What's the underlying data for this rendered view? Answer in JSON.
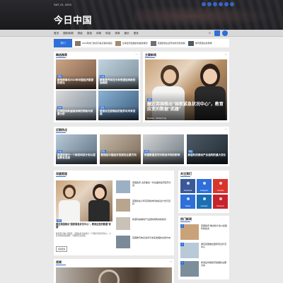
{
  "header": {
    "date": "SAT, 01, 2023",
    "site_title": "今日中国"
  },
  "nav": {
    "items": [
      "首页",
      "国际新闻",
      "财经",
      "旅游",
      "体育",
      "科技",
      "体育",
      "娱乐",
      "更多"
    ]
  },
  "ticker": {
    "label": "热门",
    "items": [
      "2023年热门新闻与焦点事件报道",
      "全球经济发展的新趋势展望",
      "英国旅游业复苏的新景象观察",
      "体育赛事全新赛季"
    ]
  },
  "section1": {
    "title": "精选推荐",
    "arrows": "‹ ›",
    "cards": [
      {
        "cat": "国际",
        "caption": "新冠病毒与2022年中国经济展望的变化"
      },
      {
        "cat": "科技",
        "caption": "新能源汽车在今年有望迎来新的高峰期"
      },
      {
        "cat": "财经",
        "caption": "在英国创新金融领域的突破与前景分析"
      },
      {
        "cat": "旅游",
        "caption": "旅游业在疫情后的复苏与未来发展"
      }
    ]
  },
  "section2": {
    "title": "主要新闻",
    "arrows": "‹ ›",
    "feature": {
      "cat": "国际",
      "caption": "据近英国推出\"国家紧急状况中心\"，教育应变的数据\"武器\"",
      "meta": "By Admin · 2023年1月1日"
    }
  },
  "section3": {
    "title": "近期热点",
    "arrows": "‹ ›",
    "cards": [
      {
        "cat": "科技",
        "caption": "英国将推行一个新的科技计划以提高教育发展"
      },
      {
        "cat": "国际",
        "caption": "新冠后中国经济发展的主要方向"
      },
      {
        "cat": "财经",
        "caption": "年度数据发布对财经市场的影响"
      },
      {
        "cat": "科技",
        "caption": "新型科技推动产业结构的重大变化"
      }
    ]
  },
  "section4": {
    "title": "深度报道",
    "feature": {
      "cat": "国际",
      "caption": "据近英国推出\"国家紧急状况中心\"，教育应变的数据\"武器\"",
      "excerpt": "据英国广播公司报道，英国政府宣布成立一个国家紧急状况中心，以应对各种突发事件，并提供应急资源。",
      "readmore": "阅读更多"
    },
    "list": [
      "英国政府 决定推出一份全面的经济复苏计划",
      "英国将在今年实现新的科技投资计划与目标",
      "新型科技推动产业结构调整的新模式",
      "英国教育体系改革与未来发展的关键方向"
    ]
  },
  "sidebar": {
    "follow_title": "关注我们",
    "socials": [
      {
        "name": "Facebook",
        "color": "#3b5998"
      },
      {
        "name": "Instagram",
        "color": "#2e6fd8"
      },
      {
        "name": "Youtube",
        "color": "#d8352e"
      },
      {
        "name": "Twitter",
        "color": "#2e6fd8"
      },
      {
        "name": "Linkedin",
        "color": "#1d6fb5"
      },
      {
        "name": "Pinterest",
        "color": "#c8232c"
      }
    ],
    "popular_title": "热门新闻",
    "popular": [
      "英国政府 推出新计划以加强科技投资",
      "据近英国推出国家紧急状况中心",
      "新冠后中国经济发展的主要方向"
    ]
  },
  "section5": {
    "title": "视频",
    "arrows": "‹ ›"
  }
}
